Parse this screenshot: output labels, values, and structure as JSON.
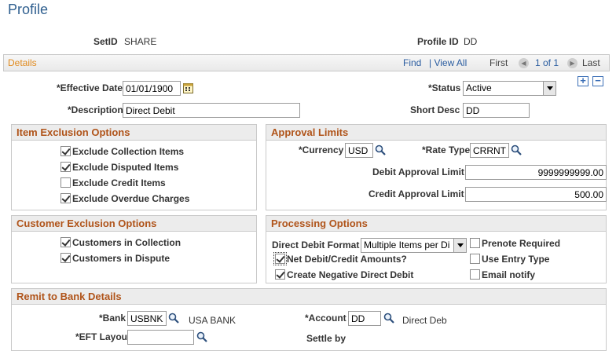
{
  "page": {
    "title": "Profile"
  },
  "header": {
    "setid_label": "SetID",
    "setid_value": "SHARE",
    "profile_label": "Profile ID",
    "profile_value": "DD"
  },
  "details": {
    "title": "Details",
    "find": "Find",
    "view_all": "| View All",
    "first": "First",
    "count": "1 of 1",
    "last": "Last",
    "add": "+",
    "remove": "−"
  },
  "form": {
    "eff_date_label": "*Effective Date",
    "eff_date_value": "01/01/1900",
    "status_label": "*Status",
    "status_value": "Active",
    "desc_label": "*Description",
    "desc_value": "Direct Debit",
    "short_desc_label": "Short Desc",
    "short_desc_value": "DD"
  },
  "item_exclusion": {
    "title": "Item Exclusion Options",
    "items": [
      {
        "label": "Exclude Collection Items",
        "checked": true
      },
      {
        "label": "Exclude Disputed Items",
        "checked": true
      },
      {
        "label": "Exclude Credit Items",
        "checked": false
      },
      {
        "label": "Exclude Overdue Charges",
        "checked": true
      }
    ]
  },
  "approval": {
    "title": "Approval Limits",
    "currency_label": "*Currency",
    "currency_value": "USD",
    "rate_label": "*Rate Type",
    "rate_value": "CRRNT",
    "debit_label": "Debit Approval Limit",
    "debit_value": "9999999999.00",
    "credit_label": "Credit Approval Limit",
    "credit_value": "500.00"
  },
  "customer_exclusion": {
    "title": "Customer Exclusion Options",
    "items": [
      {
        "label": "Customers in Collection",
        "checked": true
      },
      {
        "label": "Customers in Dispute",
        "checked": true
      }
    ]
  },
  "processing": {
    "title": "Processing Options",
    "format_label": "Direct Debit Format",
    "format_value": "Multiple Items per Di",
    "net_label": "Net Debit/Credit Amounts?",
    "net_checked": true,
    "negative_label": "Create Negative Direct Debit",
    "negative_checked": true,
    "prenote_label": "Prenote Required",
    "prenote_checked": false,
    "entry_label": "Use Entry Type",
    "entry_checked": false,
    "email_label": "Email notify",
    "email_checked": false
  },
  "remit": {
    "title": "Remit to Bank Details",
    "bank_label": "*Bank",
    "bank_value": "USBNK",
    "bank_desc": "USA BANK",
    "account_label": "*Account",
    "account_value": "DD",
    "account_desc": "Direct Deb",
    "eft_label": "*EFT Layout",
    "eft_value": "",
    "settle_label": "Settle by"
  },
  "colors": {
    "title": "#2f5f8f",
    "section_header": "#b0541a",
    "details_title": "#e08a1e",
    "link": "#2b5da0"
  }
}
